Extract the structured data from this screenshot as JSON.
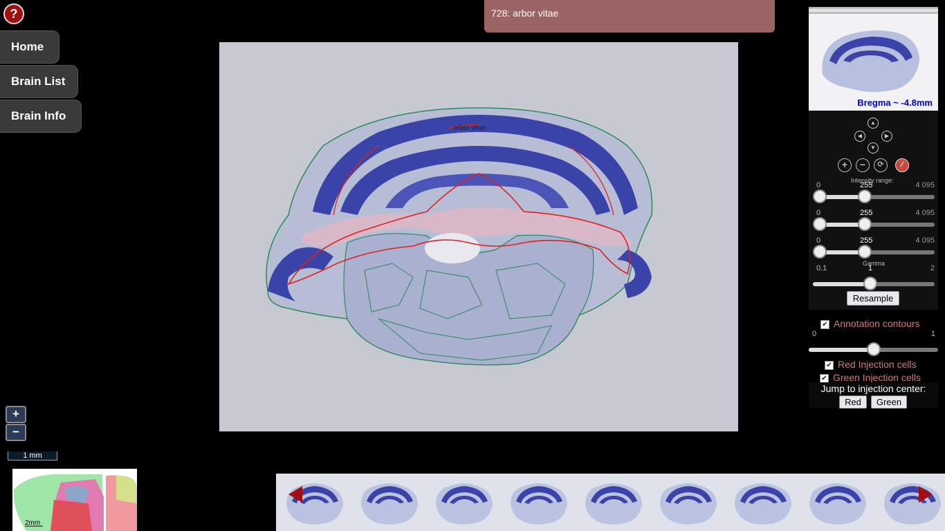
{
  "help": {
    "label": "?"
  },
  "nav": {
    "home": "Home",
    "brain_list": "Brain List",
    "brain_info": "Brain Info"
  },
  "tooltip": {
    "text": "728: arbor vitae"
  },
  "viewer": {
    "region_label": "arbor vitae"
  },
  "zoom": {
    "in": "+",
    "out": "−"
  },
  "scalebar": {
    "label": "1 mm"
  },
  "minimap": {
    "scale_label": "2mm"
  },
  "panel": {
    "bregma": "Bregma ~ -4.8mm",
    "intensity_label": "Intensity range:",
    "channels": [
      {
        "min": "0",
        "value": "255",
        "max": "4 095"
      },
      {
        "min": "0",
        "value": "255",
        "max": "4 095"
      },
      {
        "min": "0",
        "value": "255",
        "max": "4 095"
      }
    ],
    "gamma": {
      "label": "Gamma",
      "min": "0.1",
      "value": "1",
      "max": "2"
    },
    "resample": "Resample",
    "annotation_contours": "Annotation contours",
    "opacity": {
      "min": "0",
      "max": "1",
      "value": 0.55
    },
    "red_injection": "Red Injection cells",
    "green_injection": "Green Injection cells",
    "jump_label": "Jump to injection center:",
    "jump_red": "Red",
    "jump_green": "Green"
  },
  "colors": {
    "tooltip_bg": "#9b6464",
    "help_bg": "#a10f0f",
    "bregma_text": "#0000c8",
    "contour_red": "#e02020",
    "contour_green": "#2a8a5a",
    "tissue_blue": "#3a44a8"
  }
}
